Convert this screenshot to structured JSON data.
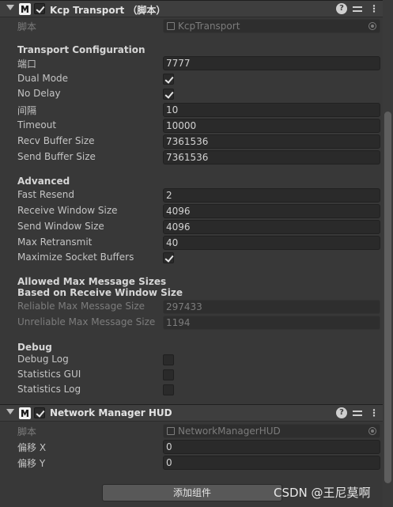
{
  "kcp": {
    "title": "Kcp Transport （脚本）",
    "script_label": "脚本",
    "script_value": "KcpTransport",
    "transport_config_title": "Transport Configuration",
    "port_label": "端口",
    "port_value": "7777",
    "dual_mode_label": "Dual Mode",
    "dual_mode": true,
    "no_delay_label": "No Delay",
    "no_delay": true,
    "interval_label": "间隔",
    "interval_value": "10",
    "timeout_label": "Timeout",
    "timeout_value": "10000",
    "recv_buffer_label": "Recv Buffer Size",
    "recv_buffer_value": "7361536",
    "send_buffer_label": "Send Buffer Size",
    "send_buffer_value": "7361536",
    "advanced_title": "Advanced",
    "fast_resend_label": "Fast Resend",
    "fast_resend_value": "2",
    "recv_window_label": "Receive Window Size",
    "recv_window_value": "4096",
    "send_window_label": "Send Window Size",
    "send_window_value": "4096",
    "max_retransmit_label": "Max Retransmit",
    "max_retransmit_value": "40",
    "max_socket_label": "Maximize Socket Buffers",
    "max_socket": true,
    "allowed_title_1": "Allowed Max Message Sizes",
    "allowed_title_2": "Based on Receive Window Size",
    "reliable_label": "Reliable Max Message Size",
    "reliable_value": "297433",
    "unreliable_label": "Unreliable Max Message Size",
    "unreliable_value": "1194",
    "debug_title": "Debug",
    "debug_log_label": "Debug Log",
    "debug_log": false,
    "stats_gui_label": "Statistics GUI",
    "stats_gui": false,
    "stats_log_label": "Statistics Log",
    "stats_log": false
  },
  "hud": {
    "title": "Network Manager HUD",
    "script_label": "脚本",
    "script_value": "NetworkManagerHUD",
    "offset_x_label": "偏移 X",
    "offset_x_value": "0",
    "offset_y_label": "偏移 Y",
    "offset_y_value": "0"
  },
  "add_component_label": "添加组件",
  "watermark": "CSDN @王尼莫啊",
  "icons": {
    "fold": "fold-arrow-icon",
    "script": "unity-script-icon",
    "help": "help-icon",
    "preset": "preset-icon",
    "more": "more-icon",
    "object_field": "script-asset-icon",
    "target": "object-picker-icon"
  }
}
